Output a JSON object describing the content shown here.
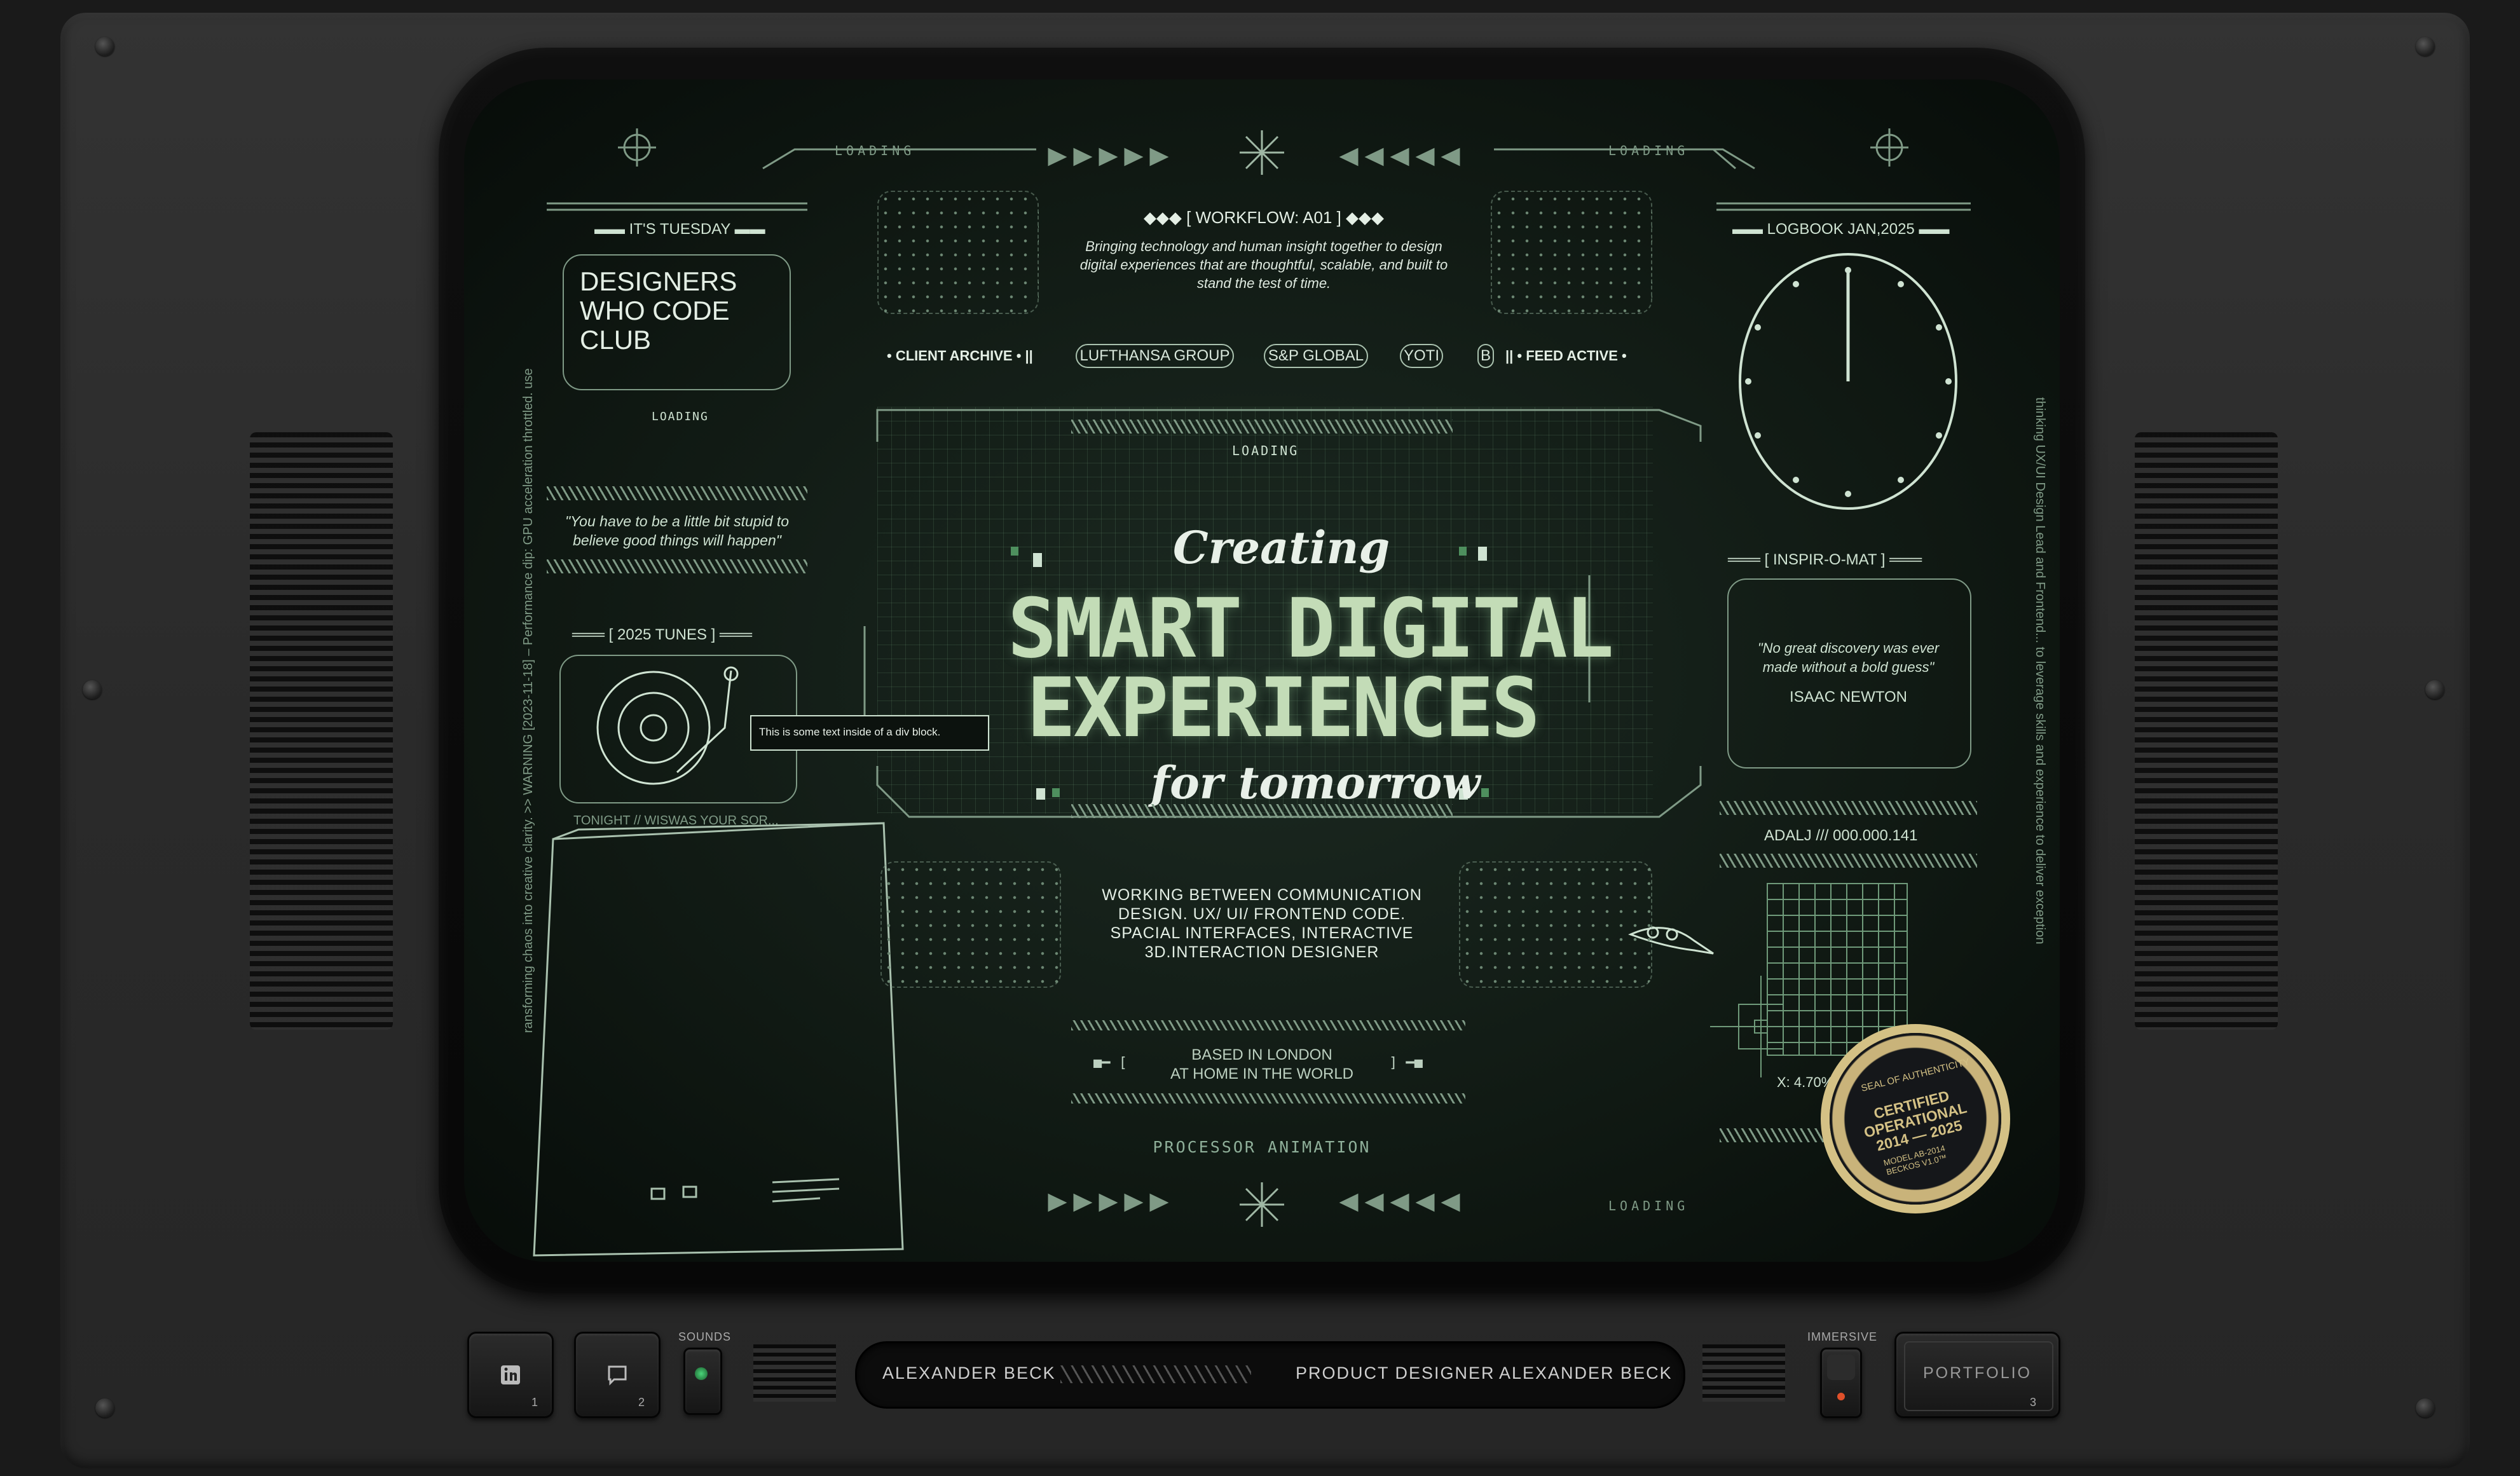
{
  "screen": {
    "loading_labels": [
      "LOADING",
      "LOADING",
      "LOADING",
      "LOADING",
      "LOADING"
    ],
    "left": {
      "day": "IT'S TUESDAY",
      "club": [
        "DESIGNERS",
        "WHO CODE",
        "CLUB"
      ],
      "quote": [
        "\"You have to be a little bit stupid to",
        "believe good things will happen\""
      ],
      "tunes_title": "2025 TUNES",
      "tooltip": "This is some text inside of a div block.",
      "tonight": "TONIGHT // WISWAS YOUR SOR...",
      "vertical_text": "ransforming chaos into creative clarity. >> WARNING [2023-11-18] – Performance dip: GPU acceleration throttled. use"
    },
    "center": {
      "workflow": "◆◆◆ [ WORKFLOW: A01 ] ◆◆◆",
      "tagline": [
        "Bringing technology and human insight together to design",
        "digital experiences that are thoughtful, scalable, and built to",
        "stand the test of time."
      ],
      "client_archive": "CLIENT ARCHIVE",
      "clients": [
        "LUFTHANSA GROUP",
        "S&P GLOBAL",
        "YOTI",
        "B"
      ],
      "feed_active": "FEED ACTIVE",
      "creating": "Creating",
      "title1": "SMART DIGITAL",
      "title2": "EXPERIENCES",
      "tomorrow": "for tomorrow",
      "description": [
        "WORKING BETWEEN COMMUNICATION",
        "DESIGN. UX/ UI/ FRONTEND CODE.",
        "SPACIAL INTERFACES, INTERACTIVE",
        "3D.INTERACTION DESIGNER"
      ],
      "location": [
        "BASED IN LONDON",
        "AT HOME IN THE WORLD"
      ],
      "processor": "PROCESSOR ANIMATION"
    },
    "right": {
      "logbook": "LOGBOOK JAN,2025",
      "inspir": "INSPIR-O-MAT",
      "quote": [
        "\"No great discovery was ever",
        "made without a bold guess\""
      ],
      "author": "ISAAC NEWTON",
      "coords": "ADALJ /// 000.000.141",
      "x_readout": "X: 4.70%",
      "vertical_text": "thinking UX/UI Design Lead and Frontend... to leverage skills and experience to deliver exception",
      "seal": {
        "top": "SEAL OF AUTHENTICITY",
        "main": [
          "CERTIFIED",
          "OPERATIONAL",
          "2014 — 2025"
        ],
        "bottom": [
          "MODEL AB-2014",
          "BECKOS V1.0™"
        ]
      }
    }
  },
  "controls": {
    "linkedin_num": "1",
    "chat_num": "2",
    "sounds_label": "SOUNDS",
    "immersive_label": "IMMERSIVE",
    "portfolio_label": "PORTFOLIO",
    "portfolio_num": "3",
    "bar_name": "ALEXANDER BECK",
    "bar_role": "PRODUCT DESIGNER",
    "bar_name2": "ALEXANDER BECK"
  },
  "colors": {
    "phosphor": "#c3dcb7",
    "accent_green": "#4bd67a",
    "record_red": "#e0502a",
    "seal_gold": "#d4c185"
  }
}
